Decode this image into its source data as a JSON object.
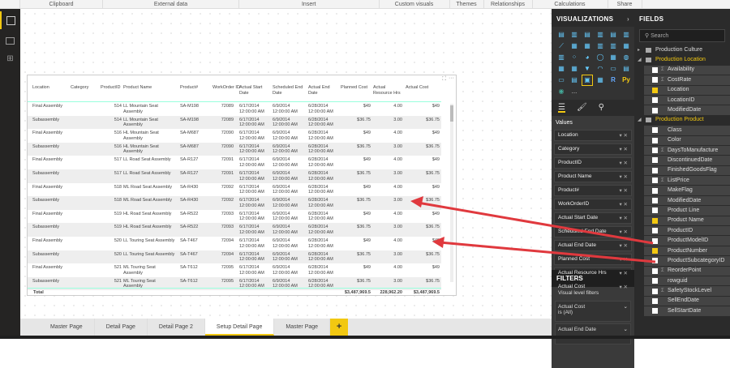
{
  "ribbon": [
    "Clipboard",
    "External data",
    "Insert",
    "Custom visuals",
    "Themes",
    "Relationships",
    "Calculations",
    "Share"
  ],
  "table": {
    "headers": [
      "Location",
      "Category",
      "ProductID",
      "Product Name",
      "Product#",
      "WorkOrder ID",
      "Actual Start Date",
      "Scheduled End Date",
      "Actual End Date",
      "Planned Cost",
      "Actual Resource Hrs",
      "Actual Cost"
    ],
    "rows": [
      [
        "Final Assembly",
        "",
        "514",
        "LL Mountain Seat Assembly",
        "SA-M198",
        "72089",
        "6/17/2014 12:00:00 AM",
        "6/9/2014 12:00:00 AM",
        "6/28/2014 12:00:00 AM",
        "$49",
        "4.00",
        "$49"
      ],
      [
        "Subassembly",
        "",
        "514",
        "LL Mountain Seat Assembly",
        "SA-M198",
        "72089",
        "6/17/2014 12:00:00 AM",
        "6/9/2014 12:00:00 AM",
        "6/28/2014 12:00:00 AM",
        "$36.75",
        "3.00",
        "$36.75"
      ],
      [
        "Final Assembly",
        "",
        "516",
        "HL Mountain Seat Assembly",
        "SA-M687",
        "72090",
        "6/17/2014 12:00:00 AM",
        "6/9/2014 12:00:00 AM",
        "6/28/2014 12:00:00 AM",
        "$49",
        "4.00",
        "$49"
      ],
      [
        "Subassembly",
        "",
        "516",
        "HL Mountain Seat Assembly",
        "SA-M687",
        "72090",
        "6/17/2014 12:00:00 AM",
        "6/9/2014 12:00:00 AM",
        "6/28/2014 12:00:00 AM",
        "$36.75",
        "3.00",
        "$36.75"
      ],
      [
        "Final Assembly",
        "",
        "517",
        "LL Road Seat Assembly",
        "SA-R127",
        "72091",
        "6/17/2014 12:00:00 AM",
        "6/9/2014 12:00:00 AM",
        "6/28/2014 12:00:00 AM",
        "$49",
        "4.00",
        "$49"
      ],
      [
        "Subassembly",
        "",
        "517",
        "LL Road Seat Assembly",
        "SA-R127",
        "72091",
        "6/17/2014 12:00:00 AM",
        "6/9/2014 12:00:00 AM",
        "6/28/2014 12:00:00 AM",
        "$36.75",
        "3.00",
        "$36.75"
      ],
      [
        "Final Assembly",
        "",
        "518",
        "ML Road Seat Assembly",
        "SA-R430",
        "72092",
        "6/17/2014 12:00:00 AM",
        "6/9/2014 12:00:00 AM",
        "6/28/2014 12:00:00 AM",
        "$49",
        "4.00",
        "$49"
      ],
      [
        "Subassembly",
        "",
        "518",
        "ML Road Seat Assembly",
        "SA-R430",
        "72092",
        "6/17/2014 12:00:00 AM",
        "6/9/2014 12:00:00 AM",
        "6/28/2014 12:00:00 AM",
        "$36.75",
        "3.00",
        "$36.75"
      ],
      [
        "Final Assembly",
        "",
        "519",
        "HL Road Seat Assembly",
        "SA-R522",
        "72093",
        "6/17/2014 12:00:00 AM",
        "6/9/2014 12:00:00 AM",
        "6/28/2014 12:00:00 AM",
        "$49",
        "4.00",
        "$49"
      ],
      [
        "Subassembly",
        "",
        "519",
        "HL Road Seat Assembly",
        "SA-R522",
        "72093",
        "6/17/2014 12:00:00 AM",
        "6/9/2014 12:00:00 AM",
        "6/28/2014 12:00:00 AM",
        "$36.75",
        "3.00",
        "$36.75"
      ],
      [
        "Final Assembly",
        "",
        "520",
        "LL Touring Seat Assembly",
        "SA-T467",
        "72094",
        "6/17/2014 12:00:00 AM",
        "6/9/2014 12:00:00 AM",
        "6/28/2014 12:00:00 AM",
        "$49",
        "4.00",
        "$49"
      ],
      [
        "Subassembly",
        "",
        "520",
        "LL Touring Seat Assembly",
        "SA-T467",
        "72094",
        "6/17/2014 12:00:00 AM",
        "6/9/2014 12:00:00 AM",
        "6/28/2014 12:00:00 AM",
        "$36.75",
        "3.00",
        "$36.75"
      ],
      [
        "Final Assembly",
        "",
        "521",
        "ML Touring Seat Assembly",
        "SA-T612",
        "72095",
        "6/17/2014 12:00:00 AM",
        "6/9/2014 12:00:00 AM",
        "6/28/2014 12:00:00 AM",
        "$49",
        "4.00",
        "$49"
      ],
      [
        "Subassembly",
        "",
        "521",
        "ML Touring Seat Assembly",
        "SA-T612",
        "72095",
        "6/17/2014 12:00:00 AM",
        "6/9/2014 12:00:00 AM",
        "6/28/2014 12:00:00 AM",
        "$36.75",
        "3.00",
        "$36.75"
      ]
    ],
    "total": {
      "label": "Total",
      "planned_cost": "$3,487,969.5",
      "actual_resource_hrs": "228,962.20",
      "actual_cost": "$3,487,969.5"
    }
  },
  "visualizations": {
    "title": "VISUALIZATIONS",
    "values_label": "Values",
    "wells": [
      "Location",
      "Category",
      "ProductID",
      "Product Name",
      "Product#",
      "WorkOrderID",
      "Actual Start Date",
      "Scheduled End Date",
      "Actual End Date",
      "Planned Cost",
      "Actual Resource Hrs",
      "Actual Cost"
    ],
    "r_label": "R",
    "py_label": "Py",
    "more_label": "..."
  },
  "filters": {
    "title": "FILTERS",
    "section": "Visual level filters",
    "items": [
      {
        "name": "Actual Cost",
        "value": "is (All)"
      },
      {
        "name": "Actual End Date",
        "value": ""
      }
    ]
  },
  "fields": {
    "title": "FIELDS",
    "search_placeholder": "Search",
    "items": [
      {
        "type": "table",
        "label": "Production Culture",
        "expanded": false,
        "highlight": false
      },
      {
        "type": "table",
        "label": "Production Location",
        "expanded": true,
        "highlight": true
      },
      {
        "type": "field",
        "label": "Availability",
        "sigma": true,
        "checked": false
      },
      {
        "type": "field",
        "label": "CostRate",
        "sigma": true,
        "checked": false
      },
      {
        "type": "field",
        "label": "Location",
        "sigma": false,
        "checked": true
      },
      {
        "type": "field",
        "label": "LocationID",
        "sigma": false,
        "checked": false
      },
      {
        "type": "field",
        "label": "ModifiedDate",
        "sigma": false,
        "checked": false
      },
      {
        "type": "table",
        "label": "Production Product",
        "expanded": true,
        "highlight": true
      },
      {
        "type": "field",
        "label": "Class",
        "sigma": false,
        "checked": false
      },
      {
        "type": "field",
        "label": "Color",
        "sigma": false,
        "checked": false
      },
      {
        "type": "field",
        "label": "DaysToManufacture",
        "sigma": true,
        "checked": false
      },
      {
        "type": "field",
        "label": "DiscontinuedDate",
        "sigma": false,
        "checked": false
      },
      {
        "type": "field",
        "label": "FinishedGoodsFlag",
        "sigma": false,
        "checked": false
      },
      {
        "type": "field",
        "label": "ListPrice",
        "sigma": true,
        "checked": false
      },
      {
        "type": "field",
        "label": "MakeFlag",
        "sigma": false,
        "checked": false
      },
      {
        "type": "field",
        "label": "ModifiedDate",
        "sigma": false,
        "checked": false
      },
      {
        "type": "field",
        "label": "Product Line",
        "sigma": false,
        "checked": false
      },
      {
        "type": "field",
        "label": "Product Name",
        "sigma": false,
        "checked": true
      },
      {
        "type": "field",
        "label": "ProductID",
        "sigma": false,
        "checked": false
      },
      {
        "type": "field",
        "label": "ProductModelID",
        "sigma": false,
        "checked": false
      },
      {
        "type": "field",
        "label": "ProductNumber",
        "sigma": false,
        "checked": true
      },
      {
        "type": "field",
        "label": "ProductSubcategoryID",
        "sigma": false,
        "checked": false
      },
      {
        "type": "field",
        "label": "ReorderPoint",
        "sigma": true,
        "checked": false
      },
      {
        "type": "field",
        "label": "rowguid",
        "sigma": false,
        "checked": false
      },
      {
        "type": "field",
        "label": "SafetyStockLevel",
        "sigma": true,
        "checked": false
      },
      {
        "type": "field",
        "label": "SellEndDate",
        "sigma": false,
        "checked": false
      },
      {
        "type": "field",
        "label": "SellStartDate",
        "sigma": false,
        "checked": false
      }
    ]
  },
  "pages": {
    "tabs": [
      "Master Page",
      "Detail Page",
      "Detail Page 2",
      "Setup Detail Page",
      "Master Page"
    ],
    "active": 3,
    "add_label": "+"
  },
  "colors": {
    "accent": "#f2c811",
    "arrow": "#e0393e"
  }
}
